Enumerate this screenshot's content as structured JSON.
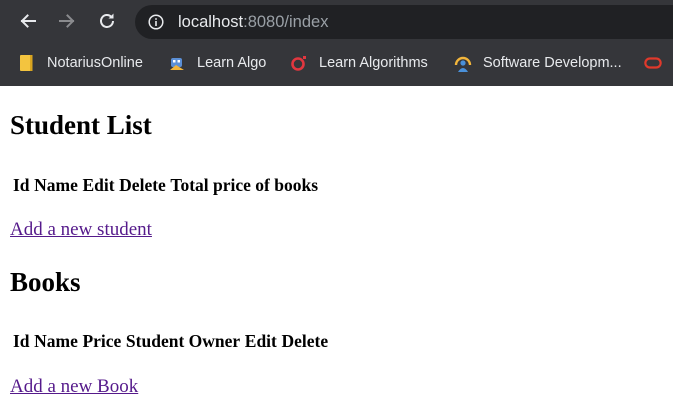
{
  "browser": {
    "url_host": "localhost",
    "url_rest": ":8080/index",
    "bookmarks": [
      {
        "label": "NotariusOnline",
        "icon": "folder-icon"
      },
      {
        "label": "Learn Algo",
        "icon": "robot-icon"
      },
      {
        "label": "Learn Algorithms",
        "icon": "ring-icon"
      },
      {
        "label": "Software Developm...",
        "icon": "person-icon"
      },
      {
        "label": "",
        "icon": "oracle-icon"
      }
    ]
  },
  "students": {
    "title": "Student List",
    "columns": [
      "Id",
      "Name",
      "Edit",
      "Delete",
      "Total price of books"
    ],
    "add_link": "Add a new student"
  },
  "books": {
    "title": "Books",
    "columns": [
      "Id",
      "Name",
      "Price",
      "Student Owner",
      "Edit",
      "Delete"
    ],
    "add_link": "Add a new Book"
  },
  "colors": {
    "chrome_bg": "#35363a",
    "omnibox_bg": "#202124",
    "visited_link": "#551a8b"
  }
}
